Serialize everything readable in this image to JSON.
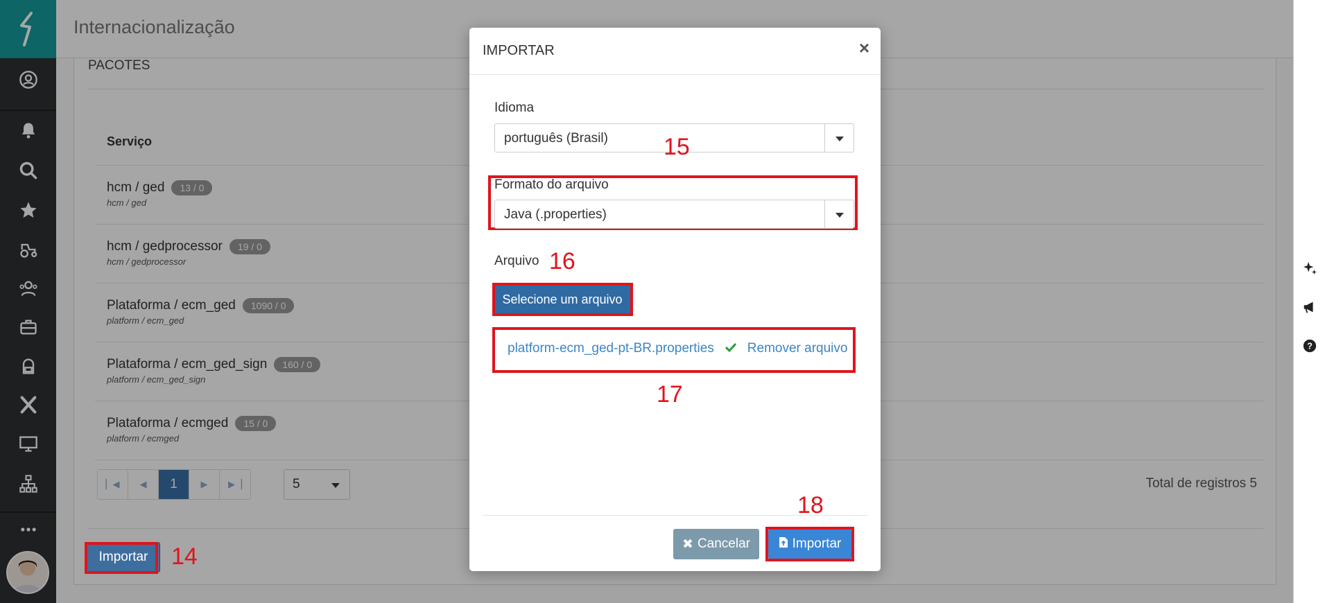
{
  "header": {
    "title": "Internacionalização"
  },
  "panel": {
    "title": "PACOTES",
    "column_service": "Serviço",
    "rows": [
      {
        "name": "hcm / ged",
        "badge": "13 / 0",
        "sub": "hcm / ged"
      },
      {
        "name": "hcm / gedprocessor",
        "badge": "19 / 0",
        "sub": "hcm / gedprocessor"
      },
      {
        "name": "Plataforma / ecm_ged",
        "badge": "1090 / 0",
        "sub": "platform / ecm_ged"
      },
      {
        "name": "Plataforma / ecm_ged_sign",
        "badge": "160 / 0",
        "sub": "platform / ecm_ged_sign"
      },
      {
        "name": "Plataforma / ecmged",
        "badge": "15 / 0",
        "sub": "platform / ecmged"
      }
    ],
    "pagination": {
      "current_page": "1",
      "page_size": "5"
    },
    "total": "Total de registros 5",
    "import_button": "Importar"
  },
  "modal": {
    "title": "IMPORTAR",
    "close": "×",
    "language_label": "Idioma",
    "language_value": "português (Brasil)",
    "format_label": "Formato do arquivo",
    "format_value": "Java (.properties)",
    "file_label": "Arquivo",
    "select_file_button": "Selecione um arquivo",
    "file_name": "platform-ecm_ged-pt-BR.properties",
    "remove_file": "Remover arquivo",
    "cancel_button": "Cancelar",
    "import_button": "Importar"
  },
  "annotations": {
    "a14": "14",
    "a15": "15",
    "a16": "16",
    "a17": "17",
    "a18": "18"
  },
  "colors": {
    "annotation_red": "#e0141d",
    "brand_teal": "#159b9b",
    "primary_blue": "#3a86d6"
  }
}
